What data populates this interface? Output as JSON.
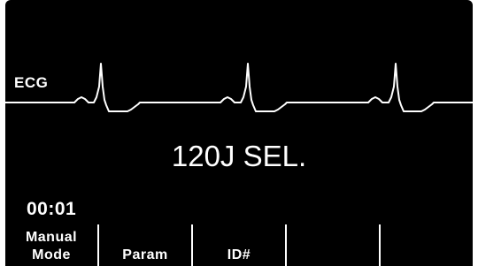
{
  "ecg": {
    "label": "ECG"
  },
  "energy": {
    "text": "120J SEL."
  },
  "timer": {
    "text": "00:01"
  },
  "softkeys": [
    {
      "line1": "Manual",
      "line2": "Mode"
    },
    {
      "line1": "",
      "line2": "Param"
    },
    {
      "line1": "",
      "line2": "ID#"
    },
    {
      "line1": "",
      "line2": ""
    },
    {
      "line1": "",
      "line2": ""
    }
  ],
  "colors": {
    "background": "#000000",
    "foreground": "#ffffff"
  }
}
